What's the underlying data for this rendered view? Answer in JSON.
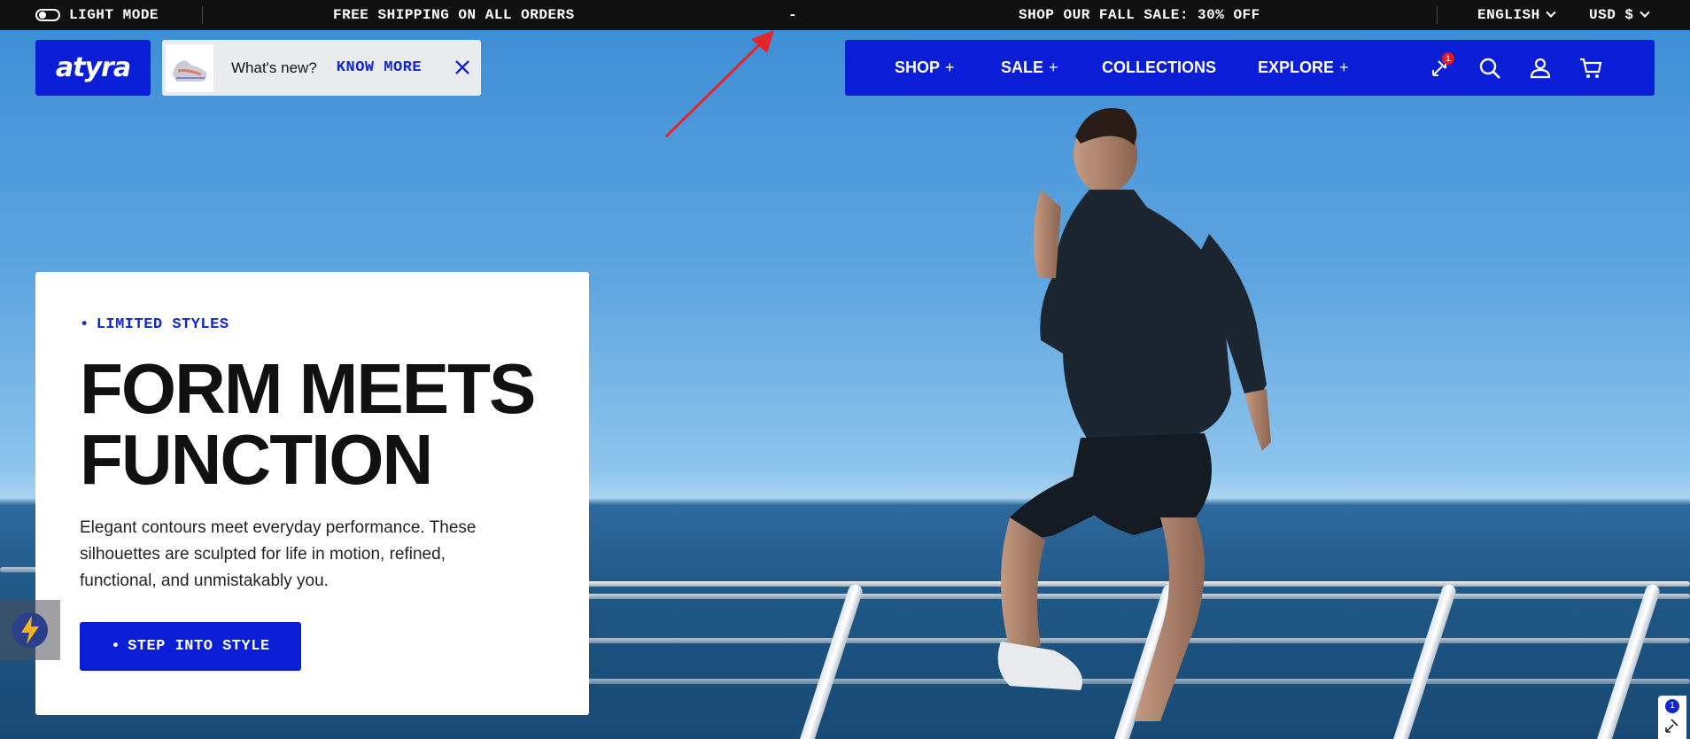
{
  "announcement": {
    "mode_label": "LIGHT MODE",
    "message_left": "FREE SHIPPING ON ALL ORDERS",
    "separator": "-",
    "message_right": "SHOP OUR FALL SALE: 30% OFF",
    "language": "ENGLISH",
    "currency": "USD $"
  },
  "header": {
    "logo_text": "atyra",
    "promo": {
      "label": "What's new?",
      "link": "KNOW MORE"
    },
    "nav": [
      {
        "label": "SHOP",
        "suffix": "+"
      },
      {
        "label": "SALE",
        "suffix": "+"
      },
      {
        "label": "COLLECTIONS",
        "suffix": ""
      },
      {
        "label": "EXPLORE",
        "suffix": "+"
      }
    ],
    "icons": {
      "compare_badge": "1",
      "compare": "compare-arrows-icon",
      "search": "search-icon",
      "account": "user-icon",
      "cart": "cart-icon"
    }
  },
  "hero": {
    "eyebrow": "LIMITED STYLES",
    "headline_line1": "FORM MEETS",
    "headline_line2": "FUNCTION",
    "description": "Elegant contours meet everyday performance. These silhouettes are sculpted for life in motion, refined, functional, and unmistakably you.",
    "cta_label": "STEP INTO STYLE"
  },
  "widgets": {
    "corner_badge": "1"
  },
  "colors": {
    "brand_blue": "#0a1ed6",
    "link_blue": "#1026d0",
    "annotation_red": "#e3262b",
    "topbar_bg": "#111111"
  }
}
